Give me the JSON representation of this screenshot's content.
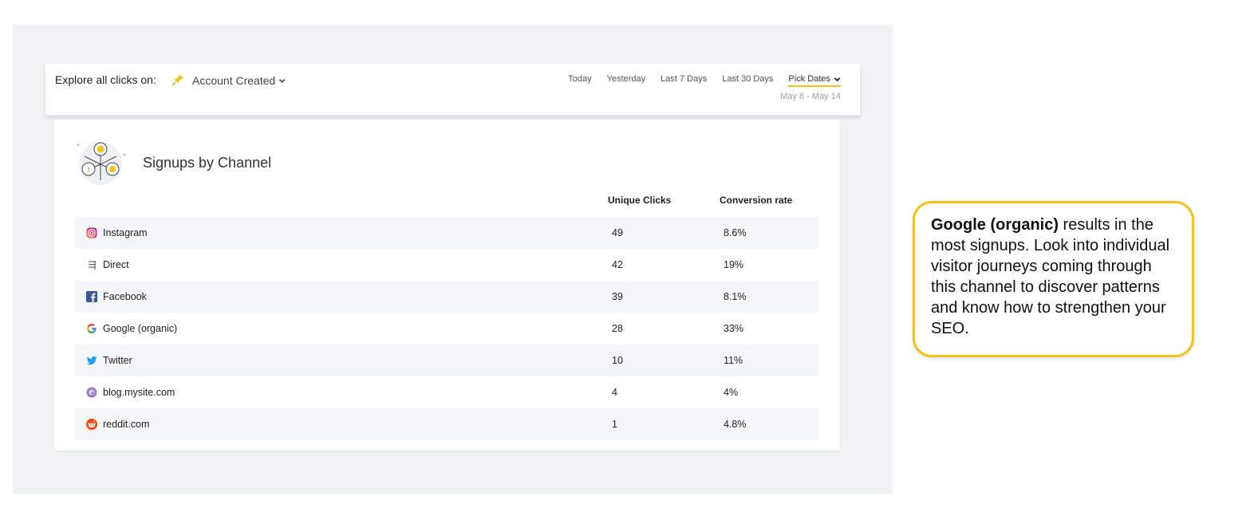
{
  "toolbar": {
    "explore_label": "Explore all clicks on:",
    "event": "Account Created",
    "date_options": [
      "Today",
      "Yesterday",
      "Last 7 Days",
      "Last 30 Days"
    ],
    "pick_dates_label": "Pick Dates",
    "date_range": "May 8 - May 14"
  },
  "card": {
    "title": "Signups by Channel",
    "columns": {
      "clicks": "Unique Clicks",
      "conversion": "Conversion rate"
    },
    "rows": [
      {
        "name": "Instagram",
        "clicks": "49",
        "conversion": "8.6%",
        "icon": "instagram-icon"
      },
      {
        "name": "Direct",
        "clicks": "42",
        "conversion": "19%",
        "icon": "direct-icon"
      },
      {
        "name": "Facebook",
        "clicks": "39",
        "conversion": "8.1%",
        "icon": "facebook-icon"
      },
      {
        "name": "Google (organic)",
        "clicks": "28",
        "conversion": "33%",
        "icon": "google-icon"
      },
      {
        "name": "Twitter",
        "clicks": "10",
        "conversion": "11%",
        "icon": "twitter-icon"
      },
      {
        "name": "blog.mysite.com",
        "clicks": "4",
        "conversion": "4%",
        "icon": "blog-icon"
      },
      {
        "name": "reddit.com",
        "clicks": "1",
        "conversion": "4.8%",
        "icon": "reddit-icon"
      }
    ]
  },
  "callout": {
    "highlight": "Google (organic)",
    "text": " results in the most signups. Look into individual visitor journeys coming through this channel to discover patterns and know how to strengthen your SEO."
  },
  "colors": {
    "accent": "#f5c217",
    "background": "#f0f3f4"
  }
}
